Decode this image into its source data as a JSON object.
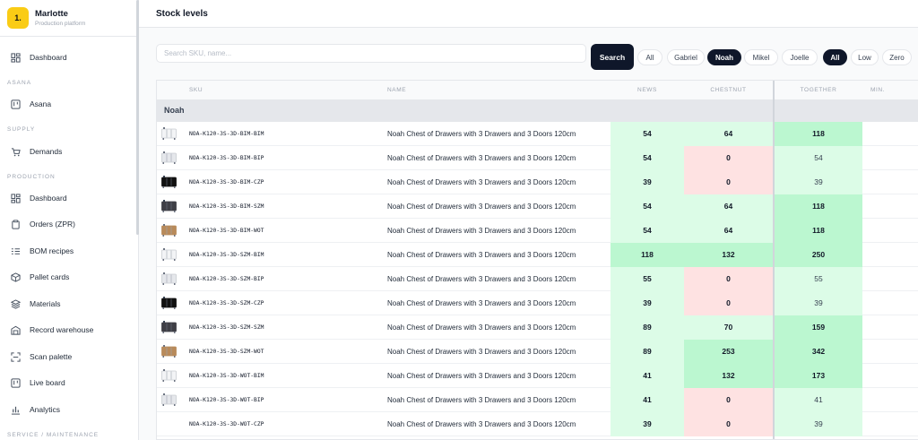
{
  "brand": {
    "name": "Marlotte",
    "subtitle": "Production platform",
    "logo_text": "1."
  },
  "nav": {
    "dashboard": "Dashboard",
    "sections": {
      "asana": "ASANA",
      "supply": "SUPPLY",
      "production": "PRODUCTION",
      "service": "SERVICE / MAINTENANCE"
    },
    "asana_item": "Asana",
    "demands": "Demands",
    "production_items": [
      {
        "label": "Dashboard",
        "icon": "layout-icon"
      },
      {
        "label": "Orders (ZPR)",
        "icon": "clipboard-icon"
      },
      {
        "label": "BOM recipes",
        "icon": "list-icon"
      },
      {
        "label": "Pallet cards",
        "icon": "package-icon"
      },
      {
        "label": "Materials",
        "icon": "layers-icon"
      },
      {
        "label": "Record warehouse",
        "icon": "warehouse-icon"
      },
      {
        "label": "Scan palette",
        "icon": "scan-icon"
      },
      {
        "label": "Live board",
        "icon": "kanban-icon"
      },
      {
        "label": "Analytics",
        "icon": "chart-icon"
      }
    ]
  },
  "page": {
    "title": "Stock levels"
  },
  "search": {
    "placeholder": "Search SKU, name...",
    "value": "",
    "button": "Search"
  },
  "owner_filters": [
    {
      "label": "All",
      "active": false
    },
    {
      "label": "Gabriel",
      "active": false
    },
    {
      "label": "Noah",
      "active": true
    },
    {
      "label": "Mikel",
      "active": false
    },
    {
      "label": "Joelle",
      "active": false
    }
  ],
  "stock_filters": [
    {
      "label": "All",
      "active": true
    },
    {
      "label": "Low",
      "active": false
    },
    {
      "label": "Zero",
      "active": false
    }
  ],
  "table": {
    "headers": {
      "sku": "SKU",
      "name": "NAME",
      "news": "NEWS",
      "chestnut": "CHESTNUT",
      "together": "TOGETHER",
      "min": "MIN."
    },
    "group": "Noah",
    "rows": [
      {
        "sku": "NOA-K120-3S-3D-BIM-BIM",
        "name": "Noah Chest of Drawers with 3 Drawers and 3 Doors 120cm",
        "news": 54,
        "chestnut": 64,
        "together": 118,
        "thumb": "white"
      },
      {
        "sku": "NOA-K120-3S-3D-BIM-BIP",
        "name": "Noah Chest of Drawers with 3 Drawers and 3 Doors 120cm",
        "news": 54,
        "chestnut": 0,
        "together": 54,
        "thumb": "lightgray"
      },
      {
        "sku": "NOA-K120-3S-3D-BIM-CZP",
        "name": "Noah Chest of Drawers with 3 Drawers and 3 Doors 120cm",
        "news": 39,
        "chestnut": 0,
        "together": 39,
        "thumb": "black"
      },
      {
        "sku": "NOA-K120-3S-3D-BIM-SZM",
        "name": "Noah Chest of Drawers with 3 Drawers and 3 Doors 120cm",
        "news": 54,
        "chestnut": 64,
        "together": 118,
        "thumb": "darkgray"
      },
      {
        "sku": "NOA-K120-3S-3D-BIM-WOT",
        "name": "Noah Chest of Drawers with 3 Drawers and 3 Doors 120cm",
        "news": 54,
        "chestnut": 64,
        "together": 118,
        "thumb": "wood"
      },
      {
        "sku": "NOA-K120-3S-3D-SZM-BIM",
        "name": "Noah Chest of Drawers with 3 Drawers and 3 Doors 120cm",
        "news": 118,
        "chestnut": 132,
        "together": 250,
        "thumb": "white"
      },
      {
        "sku": "NOA-K120-3S-3D-SZM-BIP",
        "name": "Noah Chest of Drawers with 3 Drawers and 3 Doors 120cm",
        "news": 55,
        "chestnut": 0,
        "together": 55,
        "thumb": "lightgray"
      },
      {
        "sku": "NOA-K120-3S-3D-SZM-CZP",
        "name": "Noah Chest of Drawers with 3 Drawers and 3 Doors 120cm",
        "news": 39,
        "chestnut": 0,
        "together": 39,
        "thumb": "black"
      },
      {
        "sku": "NOA-K120-3S-3D-SZM-SZM",
        "name": "Noah Chest of Drawers with 3 Drawers and 3 Doors 120cm",
        "news": 89,
        "chestnut": 70,
        "together": 159,
        "thumb": "darkgray"
      },
      {
        "sku": "NOA-K120-3S-3D-SZM-WOT",
        "name": "Noah Chest of Drawers with 3 Drawers and 3 Doors 120cm",
        "news": 89,
        "chestnut": 253,
        "together": 342,
        "thumb": "wood"
      },
      {
        "sku": "NOA-K120-3S-3D-WOT-BIM",
        "name": "Noah Chest of Drawers with 3 Drawers and 3 Doors 120cm",
        "news": 41,
        "chestnut": 132,
        "together": 173,
        "thumb": "white"
      },
      {
        "sku": "NOA-K120-3S-3D-WOT-BIP",
        "name": "Noah Chest of Drawers with 3 Drawers and 3 Doors 120cm",
        "news": 41,
        "chestnut": 0,
        "together": 41,
        "thumb": "lightgray"
      },
      {
        "sku": "NOA-K120-3S-3D-WOT-CZP",
        "name": "Noah Chest of Drawers with 3 Drawers and 3 Doors 120cm",
        "news": 39,
        "chestnut": 0,
        "together": 39,
        "thumb": "none"
      }
    ]
  },
  "colors": {
    "accent_dark": "#0f172a",
    "logo_yellow": "#facc15",
    "green_light": "#dcfce7",
    "green_strong": "#bbf7d0",
    "red_light": "#fee2e2",
    "thumb_white": "#f3f4f6",
    "thumb_lightgray": "#e5e7eb",
    "thumb_black": "#111111",
    "thumb_darkgray": "#3f3f46",
    "thumb_wood": "#b88a5a"
  }
}
